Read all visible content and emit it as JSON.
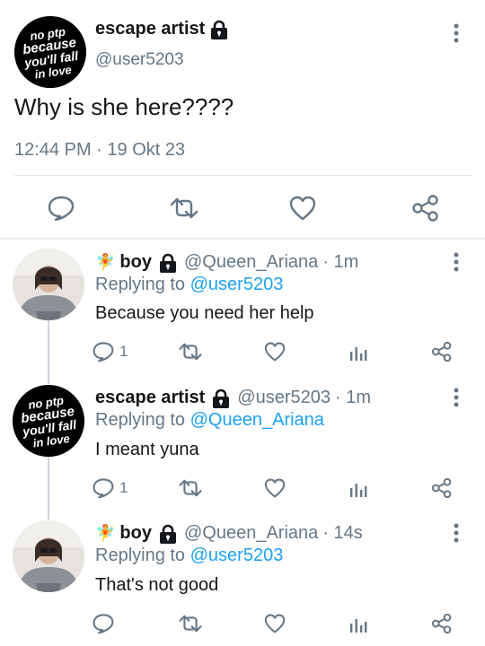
{
  "main": {
    "author": {
      "name": "escape artist",
      "handle": "@user5203",
      "avatar_lines": [
        "no ptp",
        "because",
        "you'll fall",
        "in love"
      ]
    },
    "text": "Why is she here????",
    "time": "12:44 PM",
    "dot": "·",
    "date_a": "19 Okt",
    "date_b": "23"
  },
  "replies": [
    {
      "emoji": "🧚",
      "name": "boy",
      "handle": "@Queen_Ariana",
      "age": "· 1m",
      "replying_prefix": "Replying to",
      "replying_to": "@user5203",
      "text": "Because you need her help",
      "reply_count": "1"
    },
    {
      "name": "escape artist",
      "handle": "@user5203",
      "age": "· 1m",
      "replying_prefix": "Replying to",
      "replying_to": "@Queen_Ariana",
      "text": "I meant yuna",
      "reply_count": "1",
      "avatar_lines": [
        "no ptp",
        "because",
        "you'll fall",
        "in love"
      ]
    },
    {
      "emoji": "🧚",
      "name": "boy",
      "handle": "@Queen_Ariana",
      "age": "· 14s",
      "replying_prefix": "Replying to",
      "replying_to": "@user5203",
      "text": "That's not good",
      "reply_count": ""
    }
  ],
  "colors": {
    "text": "#14171a",
    "muted": "#657786",
    "link": "#1da1f2",
    "divider": "#e1e8ed"
  }
}
